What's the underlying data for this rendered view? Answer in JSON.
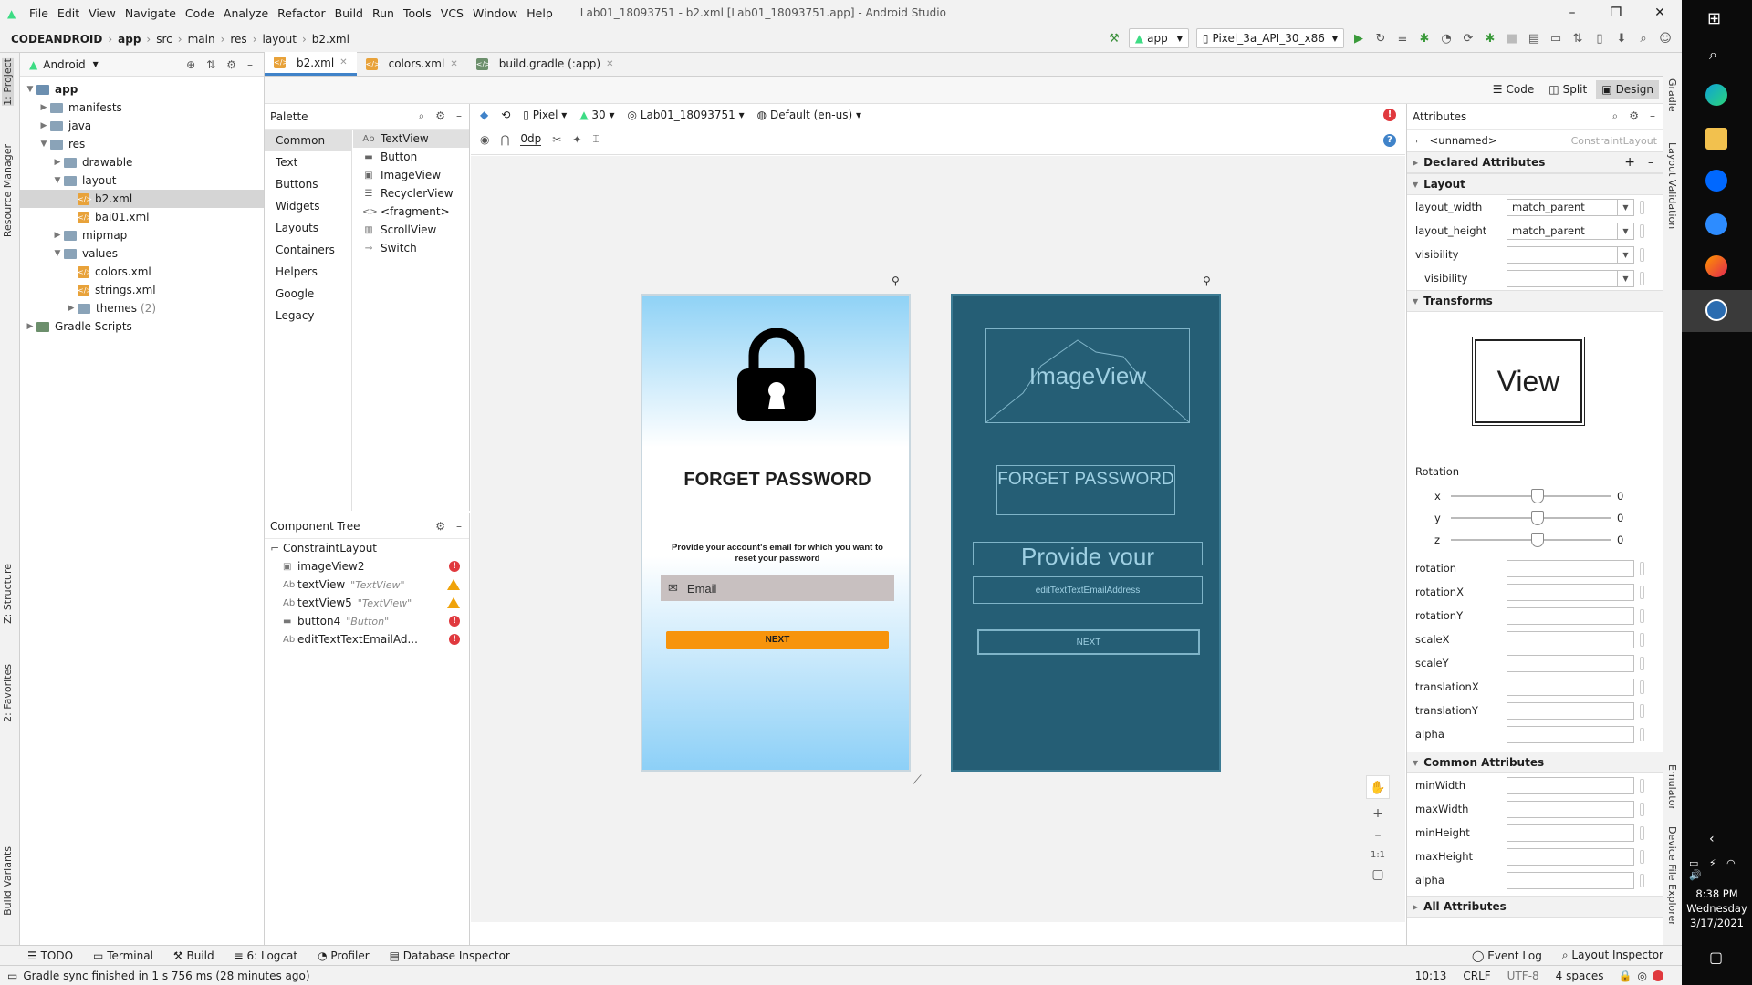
{
  "menubar": {
    "items": [
      "File",
      "Edit",
      "View",
      "Navigate",
      "Code",
      "Analyze",
      "Refactor",
      "Build",
      "Run",
      "Tools",
      "VCS",
      "Window",
      "Help"
    ],
    "title": "Lab01_18093751 - b2.xml [Lab01_18093751.app] - Android Studio"
  },
  "breadcrumbs": [
    "CODEANDROID",
    "app",
    "src",
    "main",
    "res",
    "layout",
    "b2.xml"
  ],
  "toolbar": {
    "run_config": "app",
    "device": "Pixel_3a_API_30_x86"
  },
  "project": {
    "view_mode": "Android",
    "tree": [
      {
        "label": "app",
        "level": 0,
        "bold": true,
        "open": true
      },
      {
        "label": "manifests",
        "level": 1
      },
      {
        "label": "java",
        "level": 1
      },
      {
        "label": "res",
        "level": 1,
        "open": true
      },
      {
        "label": "drawable",
        "level": 2
      },
      {
        "label": "layout",
        "level": 2,
        "open": true
      },
      {
        "label": "b2.xml",
        "level": 3,
        "file": true,
        "selected": true
      },
      {
        "label": "bai01.xml",
        "level": 3,
        "file": true
      },
      {
        "label": "mipmap",
        "level": 2
      },
      {
        "label": "values",
        "level": 2,
        "open": true
      },
      {
        "label": "colors.xml",
        "level": 3,
        "file": true
      },
      {
        "label": "strings.xml",
        "level": 3,
        "file": true
      },
      {
        "label": "themes",
        "level": 3,
        "suffix": "(2)"
      },
      {
        "label": "Gradle Scripts",
        "level": 0
      }
    ]
  },
  "editor_tabs": [
    "b2.xml",
    "colors.xml",
    "build.gradle (:app)"
  ],
  "modes": [
    "Code",
    "Split",
    "Design"
  ],
  "left_stripe": [
    "1: Project",
    "Resource Manager",
    "Z: Structure",
    "2: Favorites",
    "Build Variants"
  ],
  "right_stripe": [
    "Gradle",
    "Layout Validation",
    "Emulator",
    "Device File Explorer"
  ],
  "palette": {
    "title": "Palette",
    "categories": [
      "Common",
      "Text",
      "Buttons",
      "Widgets",
      "Layouts",
      "Containers",
      "Helpers",
      "Google",
      "Legacy"
    ],
    "items": [
      {
        "icon": "Ab",
        "label": "TextView"
      },
      {
        "icon": "▬",
        "label": "Button"
      },
      {
        "icon": "▣",
        "label": "ImageView"
      },
      {
        "icon": "☰",
        "label": "RecyclerView"
      },
      {
        "icon": "<>",
        "label": "<fragment>"
      },
      {
        "icon": "▥",
        "label": "ScrollView"
      },
      {
        "icon": "⊸",
        "label": "Switch"
      }
    ]
  },
  "surface_toolbar": {
    "device": "Pixel",
    "api": "30",
    "theme": "Lab01_18093751",
    "locale": "Default (en-us)",
    "margin": "0dp"
  },
  "component_tree": {
    "title": "Component Tree",
    "root": "ConstraintLayout",
    "items": [
      {
        "icon": "▣",
        "label": "imageView2",
        "hint": "",
        "status": "error"
      },
      {
        "icon": "Ab",
        "label": "textView",
        "hint": "\"TextView\"",
        "status": "warning"
      },
      {
        "icon": "Ab",
        "label": "textView5",
        "hint": "\"TextView\"",
        "status": "warning"
      },
      {
        "icon": "▬",
        "label": "button4",
        "hint": "\"Button\"",
        "status": "error"
      },
      {
        "icon": "Ab",
        "label": "editTextTextEmailAd...",
        "hint": "",
        "status": "error"
      }
    ]
  },
  "preview": {
    "title": "FORGET PASSWORD",
    "subtitle": "Provide your account's email for which you want to reset your password",
    "email_placeholder": "Email",
    "button": "NEXT",
    "accent": "#f7940c"
  },
  "blueprint": {
    "image": "ImageView",
    "title": "FORGET PASSWORD",
    "subtitle": "Provide your",
    "edit": "editTextTextEmailAddress",
    "button": "NEXT"
  },
  "attributes": {
    "title": "Attributes",
    "id": "<unnamed>",
    "class": "ConstraintLayout",
    "sections": {
      "declared": "Declared Attributes",
      "layout": "Layout",
      "transforms": "Transforms",
      "common": "Common Attributes",
      "all": "All Attributes"
    },
    "layout_rows": [
      {
        "label": "layout_width",
        "value": "match_parent"
      },
      {
        "label": "layout_height",
        "value": "match_parent"
      },
      {
        "label": "visibility",
        "value": ""
      },
      {
        "label": "visibility",
        "value": ""
      }
    ],
    "view_box": "View",
    "rotation_label": "Rotation",
    "rotation_axes": [
      {
        "axis": "x",
        "value": "0"
      },
      {
        "axis": "y",
        "value": "0"
      },
      {
        "axis": "z",
        "value": "0"
      }
    ],
    "transform_rows": [
      "rotation",
      "rotationX",
      "rotationY",
      "scaleX",
      "scaleY",
      "translationX",
      "translationY",
      "alpha"
    ],
    "common_rows": [
      "minWidth",
      "maxWidth",
      "minHeight",
      "maxHeight",
      "alpha"
    ]
  },
  "bottom_tabs": [
    "TODO",
    "Terminal",
    "Build",
    "6: Logcat",
    "Profiler",
    "Database Inspector"
  ],
  "bottom_right_tabs": [
    "Event Log",
    "Layout Inspector"
  ],
  "status": {
    "message": "Gradle sync finished in 1 s 756 ms (28 minutes ago)",
    "position": "10:13",
    "line_sep": "CRLF",
    "encoding": "UTF-8",
    "indent": "4 spaces"
  },
  "clock": {
    "time": "8:38 PM",
    "day": "Wednesday",
    "date": "3/17/2021"
  },
  "colors": {
    "accent": "#4083c9",
    "blueprint": "#255e75",
    "error": "#e0393e",
    "warning": "#f0a30a"
  }
}
